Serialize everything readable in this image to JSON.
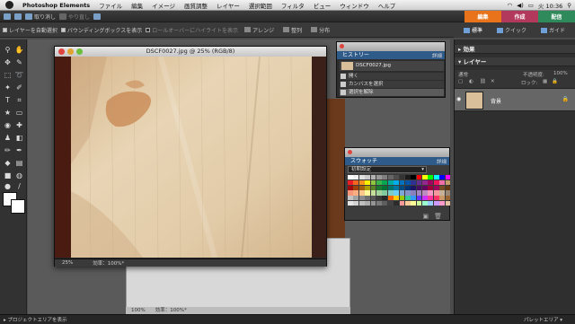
{
  "menubar": {
    "app_name": "Photoshop Elements",
    "items": [
      "ファイル",
      "編集",
      "イメージ",
      "画質調整",
      "レイヤー",
      "選択範囲",
      "フィルタ",
      "ビュー",
      "ウィンドウ",
      "ヘルプ"
    ],
    "clock": "火 10:36"
  },
  "toolbar": {
    "undo_label": "取り消し",
    "redo_label": "やり直し",
    "mode_tabs": [
      {
        "label": "編集",
        "color": "#e8731a"
      },
      {
        "label": "作成",
        "color": "#b3395c"
      },
      {
        "label": "配信",
        "color": "#2e8a5a"
      }
    ]
  },
  "options": {
    "auto_select": "レイヤーを自動選択",
    "bounding_box": "バウンディングボックスを表示",
    "rollover_highlight": "ロールオーバーにハイライトを表示",
    "arrange": "アレンジ",
    "align": "整列",
    "distribute": "分布"
  },
  "edit_modes": {
    "full": "標準",
    "quick": "クイック",
    "guided": "ガイド"
  },
  "document": {
    "title": "DSCF0027.jpg @ 25% (RGB/8)",
    "zoom": "25%",
    "efficiency": "効率：100%*"
  },
  "background_window": {
    "status": "100%　　効率：100%*"
  },
  "history": {
    "header": "ヒストリー",
    "more": "詳細",
    "file_name": "DSCF0027.jpg",
    "states": [
      "開く",
      "カンバスを選択",
      "選択を解除"
    ]
  },
  "swatches": {
    "header": "スウォッチ",
    "more": "詳細",
    "preset": "初期設定",
    "colors": [
      "#ffffff",
      "#f2f2f2",
      "#e0e0e0",
      "#cccccc",
      "#b3b3b3",
      "#999999",
      "#808080",
      "#666666",
      "#4d4d4d",
      "#333333",
      "#1a1a1a",
      "#000000",
      "#ff0000",
      "#ffff00",
      "#00ff00",
      "#00ffff",
      "#0000ff",
      "#ff00ff",
      "#ed1c24",
      "#f26522",
      "#f7941d",
      "#fff200",
      "#8dc63f",
      "#39b54a",
      "#00a651",
      "#00a99d",
      "#00aeef",
      "#0072bc",
      "#0054a6",
      "#2e3192",
      "#662d91",
      "#92278f",
      "#9e005d",
      "#ed145b",
      "#f06eaa",
      "#c69c6d",
      "#9e0b0f",
      "#a0410d",
      "#a36209",
      "#aba000",
      "#598527",
      "#1a7b30",
      "#007236",
      "#00746b",
      "#0076a3",
      "#004b80",
      "#003471",
      "#1b1464",
      "#440e62",
      "#630460",
      "#9e0039",
      "#9e005d",
      "#754c24",
      "#603913",
      "#f7977a",
      "#f9ad81",
      "#fdc68a",
      "#fff79a",
      "#c4df9b",
      "#a3d39c",
      "#82ca9d",
      "#7bcdc8",
      "#6ecff6",
      "#7ea7d8",
      "#8493ca",
      "#8882be",
      "#a187be",
      "#bc8dbf",
      "#f49ac2",
      "#f6989d",
      "#c7b299",
      "#998675",
      "#c2c2c2",
      "#a1a1a1",
      "#8a8a8a",
      "#6e6e6e",
      "#575757",
      "#3b3b3b",
      "#262626",
      "#ff6600",
      "#ffcc00",
      "#99cc00",
      "#33cc99",
      "#3399ff",
      "#6633ff",
      "#cc33ff",
      "#ff3399",
      "#ff3366",
      "#cc9966",
      "#996633",
      "#e6e6e6",
      "#d4d4d4",
      "#bfbfbf",
      "#adadad",
      "#949494",
      "#7a7a7a",
      "#5e5e5e",
      "#424242",
      "#2b2b2b",
      "#ff9999",
      "#ffcc99",
      "#ffff99",
      "#ccff99",
      "#99ffcc",
      "#99ccff",
      "#cc99ff",
      "#ff99cc",
      "#e5c3a0"
    ]
  },
  "side": {
    "effects": "効果",
    "layers": "レイヤー",
    "blend_mode": "通常",
    "opacity_label": "不透明度:",
    "opacity_value": "100%",
    "lock_label": "ロック:",
    "layer_name": "背景"
  },
  "status": {
    "project_bin": "プロジェクトエリアを表示",
    "palette_bin": "パレットエリア"
  }
}
